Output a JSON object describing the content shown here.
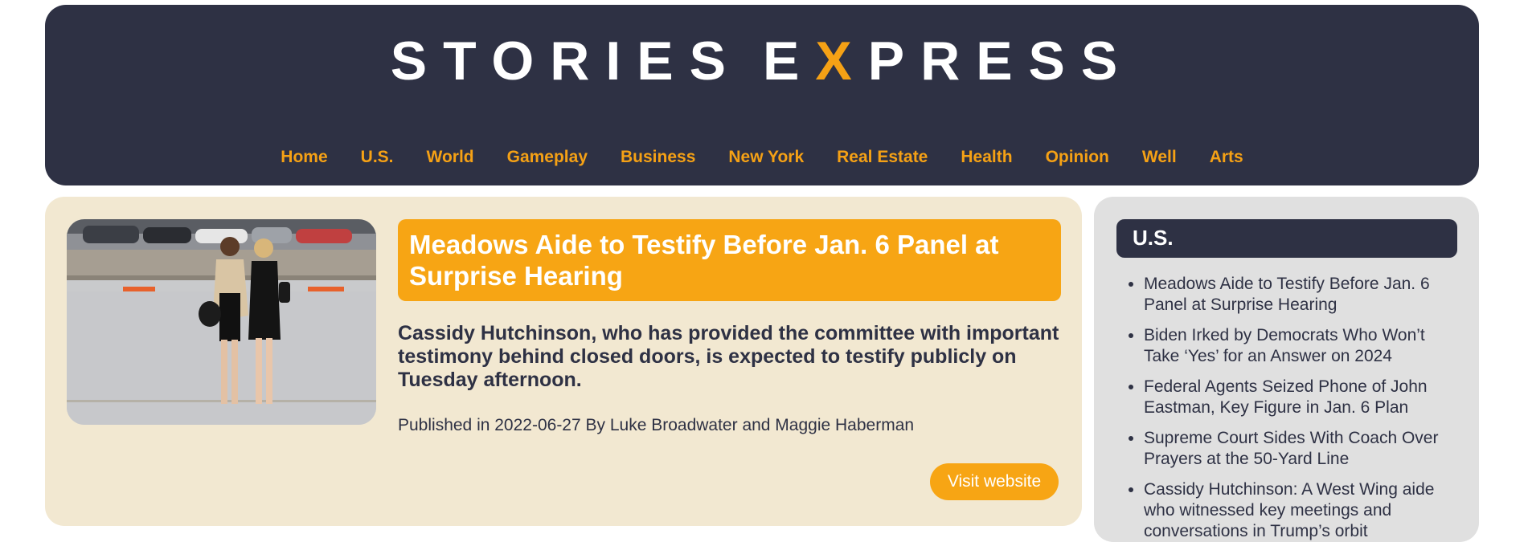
{
  "site": {
    "logo_part1": "STORIES",
    "logo_part2_pre": "E",
    "logo_part2_accent": "X",
    "logo_part2_post": "PRESS"
  },
  "nav": [
    "Home",
    "U.S.",
    "World",
    "Gameplay",
    "Business",
    "New York",
    "Real Estate",
    "Health",
    "Opinion",
    "Well",
    "Arts"
  ],
  "article": {
    "title": "Meadows Aide to Testify Before Jan. 6 Panel at Surprise Hearing",
    "summary": "Cassidy Hutchinson, who has provided the committee with important testimony behind closed doors, is expected to testify publicly on Tuesday afternoon.",
    "meta": "Published in 2022-06-27 By Luke Broadwater and Maggie Haberman",
    "visit_label": "Visit website",
    "image_alt": "Two women standing on an airport tarmac"
  },
  "sidebar": {
    "title": "U.S.",
    "items": [
      "Meadows Aide to Testify Before Jan. 6 Panel at Surprise Hearing",
      "Biden Irked by Democrats Who Won’t Take ‘Yes’ for an Answer on 2024",
      "Federal Agents Seized Phone of John Eastman, Key Figure in Jan. 6 Plan",
      "Supreme Court Sides With Coach Over Prayers at the 50-Yard Line",
      "Cassidy Hutchinson: A West Wing aide who witnessed key meetings and conversations in Trump’s orbit"
    ]
  },
  "colors": {
    "header_bg": "#2e3144",
    "accent": "#f5a115",
    "main_bg": "#f2e8d1",
    "sidebar_bg": "#e0e0e0"
  }
}
